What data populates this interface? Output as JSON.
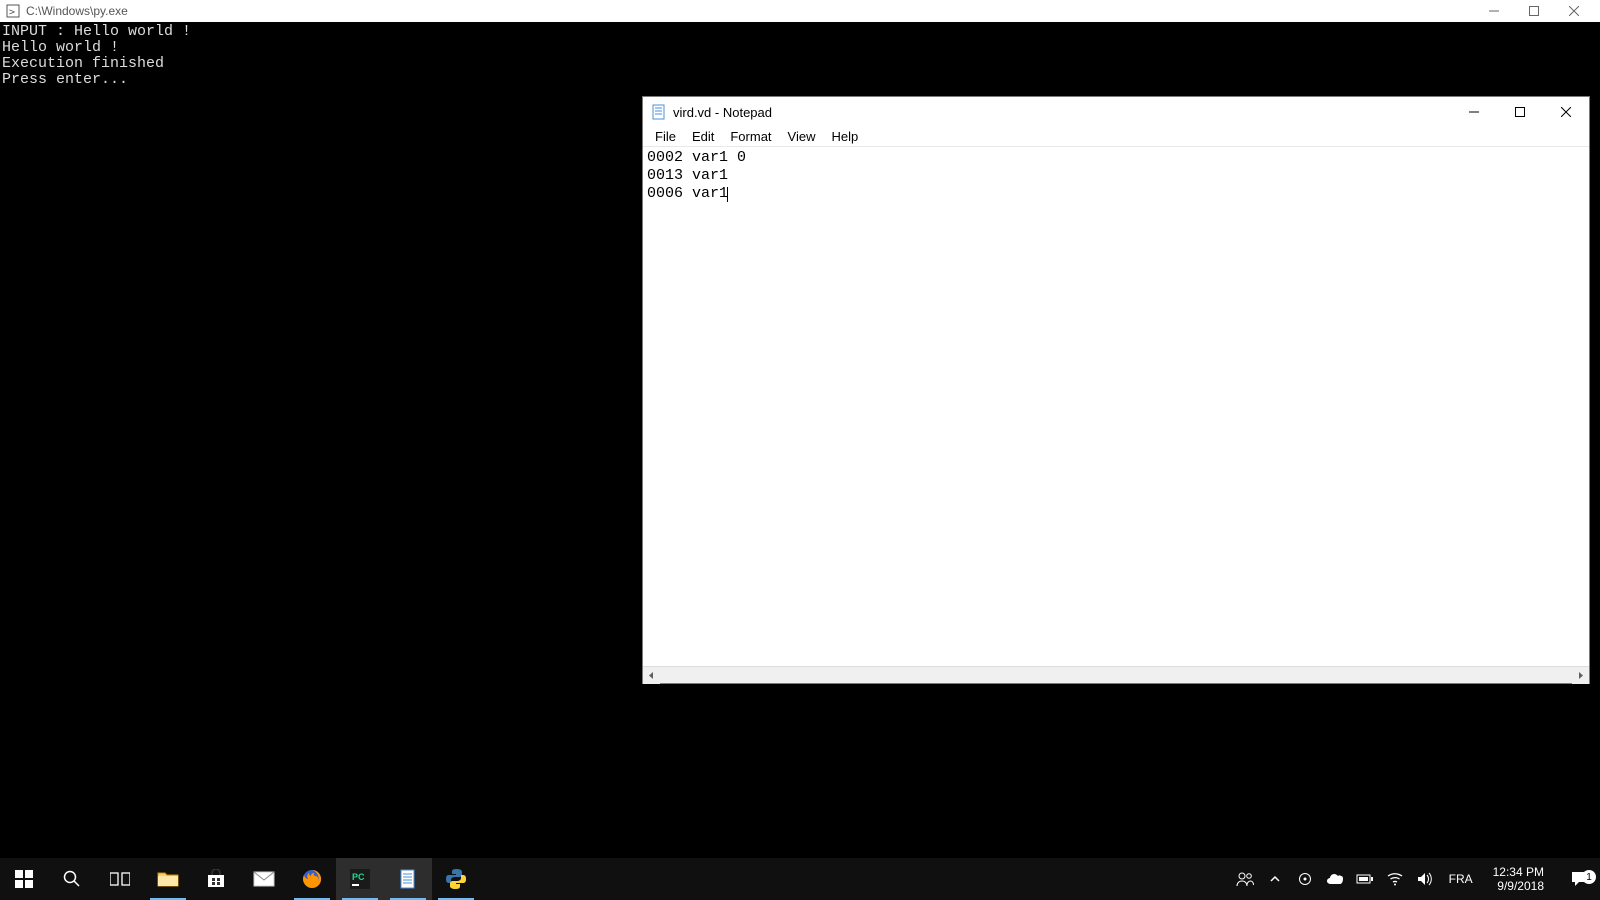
{
  "console": {
    "title": "C:\\Windows\\py.exe",
    "lines": [
      "INPUT : Hello world !",
      "Hello world !",
      "Execution finished",
      "Press enter..."
    ]
  },
  "notepad": {
    "title": "vird.vd - Notepad",
    "menu": {
      "file": "File",
      "edit": "Edit",
      "format": "Format",
      "view": "View",
      "help": "Help"
    },
    "text_lines": [
      "0002 var1 0",
      "0013 var1",
      "0006 var1"
    ]
  },
  "taskbar": {
    "lang": "FRA",
    "time": "12:34 PM",
    "date": "9/9/2018",
    "notif_count": "1"
  }
}
